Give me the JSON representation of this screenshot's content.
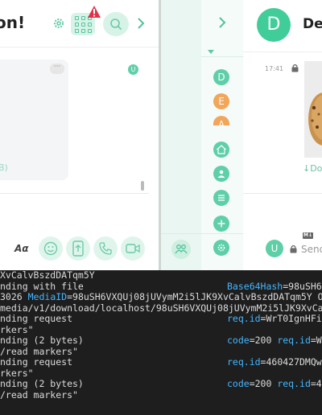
{
  "left_window": {
    "title": "on!",
    "bubble_size": "B)",
    "read_receipt_avatar": "U",
    "format_label": "Aα",
    "icons": {
      "settings": "gear-icon",
      "apps": "grid-icon",
      "alert": "warning-icon",
      "search": "search-icon",
      "collapse": "chevron-right-icon"
    },
    "toolbar_icons": [
      "emoji-icon",
      "upload-icon",
      "phone-icon",
      "video-icon"
    ]
  },
  "right_window": {
    "room_avatar_letter": "D",
    "room_title": "De",
    "rail_avatars": [
      {
        "letter": "D",
        "color": "#5ecfa8"
      },
      {
        "letter": "E",
        "color": "#f2a65a"
      },
      {
        "letter": "A",
        "color": "#f2a65a"
      }
    ],
    "rail_icons": [
      "home-icon",
      "people-icon",
      "list-icon",
      "add-icon",
      "settings-icon"
    ],
    "message_time": "17:41",
    "download_label": "↓Do",
    "md_badge": "M↓",
    "self_avatar": "U",
    "composer_placeholder": "Send"
  },
  "terminal": {
    "lines": [
      {
        "left": "XvCalvBszdDATqm5Y",
        "mid_key": "",
        "mid_val": ""
      },
      {
        "left": "nding with file",
        "mid_key": "Base64Hash",
        "mid_val": "=98uSH6"
      },
      {
        "left": "3026 ",
        "left_key": "MediaID",
        "left_val": "=98uSH6VXQUj08jUVymM2i5lJK9XvCalvBszdDATqm5Y O"
      },
      {
        "left": "media/v1/download/localhost/98uSH6VXQUj08jUVymM2i5lJK9XvCa"
      },
      {
        "left": "nding request",
        "mid_key": "req.id",
        "mid_val": "=WrT0IgnHFi"
      },
      {
        "left": "rkers\""
      },
      {
        "left": "nding (2 bytes)",
        "mid_key": "code",
        "mid_val": "=200 ",
        "mid_key2": "req.id",
        "mid_val2": "=W"
      },
      {
        "left": "/read markers\""
      },
      {
        "left": "nding request",
        "mid_key": "req.id",
        "mid_val": "=460427DMQw"
      },
      {
        "left": "rkers\""
      },
      {
        "left": "nding (2 bytes)",
        "mid_key": "code",
        "mid_val": "=200 ",
        "mid_key2": "req.id",
        "mid_val2": "=4"
      },
      {
        "left": "/read markers\""
      }
    ]
  },
  "colors": {
    "accent": "#5ecfa8",
    "accent_light": "#d7f3e8",
    "alert": "#e2324a",
    "terminal_bg": "#1e1e1e",
    "terminal_key": "#44b6ff"
  }
}
